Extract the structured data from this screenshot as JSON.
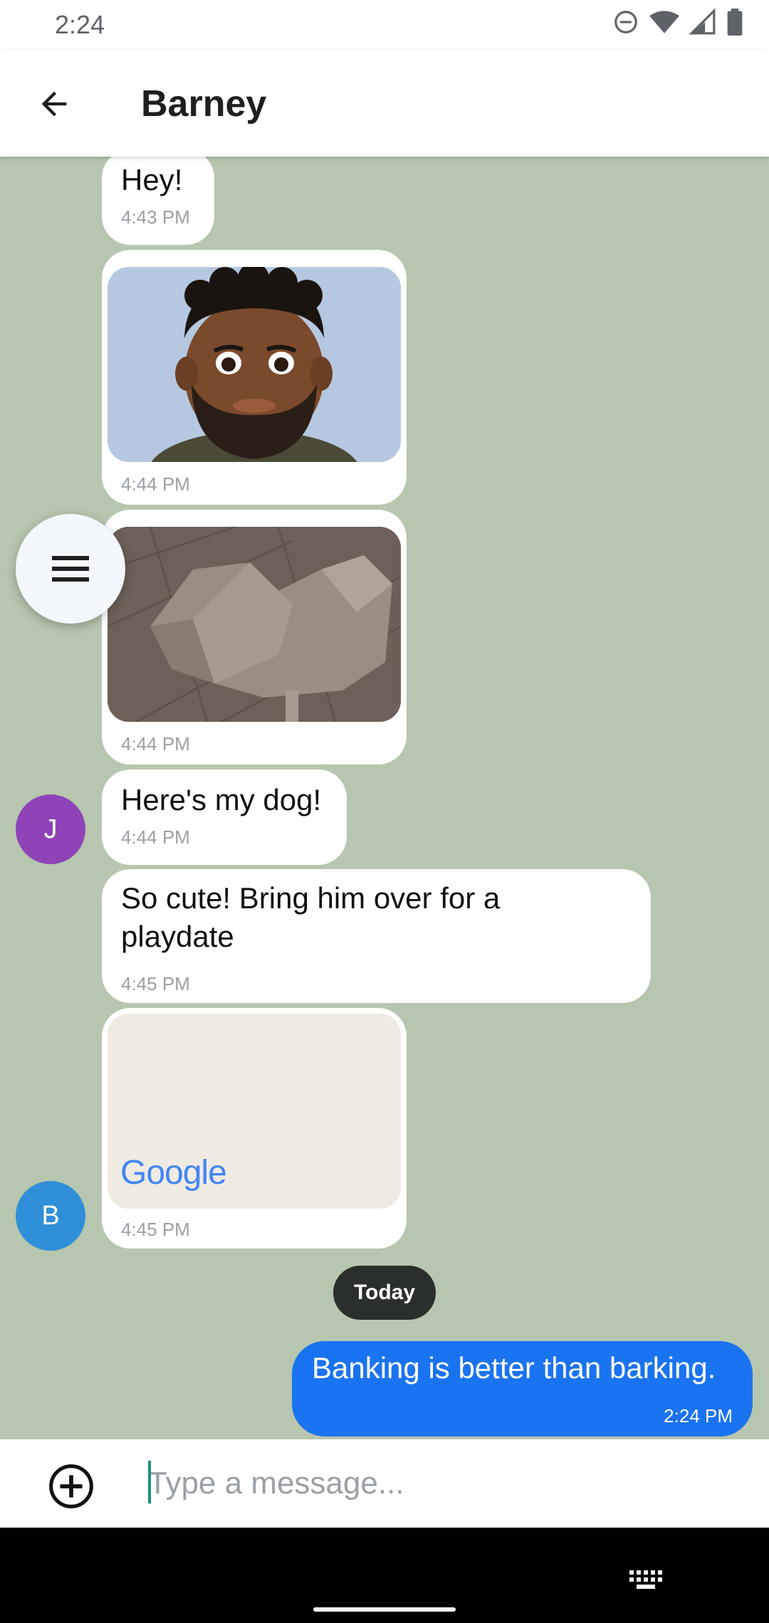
{
  "status_bar": {
    "time": "2:24"
  },
  "header": {
    "title": "Barney"
  },
  "messages": [
    {
      "type": "text",
      "text": "Hey!",
      "time": "4:43 PM"
    },
    {
      "type": "image",
      "description": "avatar-memoji",
      "time": "4:44 PM"
    },
    {
      "type": "image",
      "description": "dog-model",
      "time": "4:44 PM"
    },
    {
      "type": "text",
      "text": "Here's my dog!",
      "time": "4:44 PM",
      "sender_initial": "J"
    },
    {
      "type": "text",
      "text": "So cute! Bring him over for a playdate",
      "time": "4:45 PM"
    },
    {
      "type": "map",
      "label": "Google",
      "time": "4:45 PM",
      "sender_initial": "B"
    }
  ],
  "date_divider": "Today",
  "outgoing": {
    "text": "Banking is better than barking.",
    "time": "2:24 PM"
  },
  "composer": {
    "placeholder": "Type a message..."
  },
  "colors": {
    "chat_background": "#b7c6ae",
    "outgoing_bubble": "#1a73f0",
    "avatar_j": "#8e44b8",
    "avatar_b": "#2f8fd8"
  }
}
